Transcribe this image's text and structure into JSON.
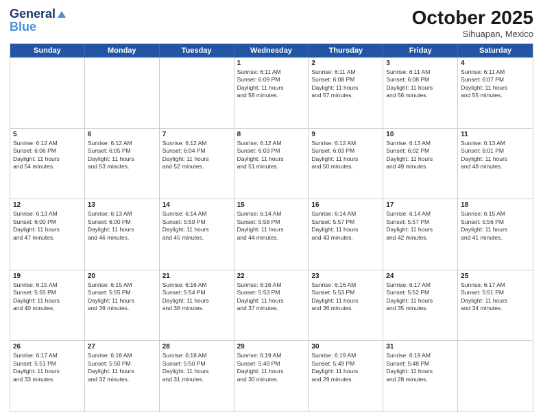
{
  "header": {
    "logo_line1": "General",
    "logo_line2": "Blue",
    "month": "October 2025",
    "location": "Sihuapan, Mexico"
  },
  "weekdays": [
    "Sunday",
    "Monday",
    "Tuesday",
    "Wednesday",
    "Thursday",
    "Friday",
    "Saturday"
  ],
  "rows": [
    [
      {
        "day": "",
        "lines": []
      },
      {
        "day": "",
        "lines": []
      },
      {
        "day": "",
        "lines": []
      },
      {
        "day": "1",
        "lines": [
          "Sunrise: 6:11 AM",
          "Sunset: 6:09 PM",
          "Daylight: 11 hours",
          "and 58 minutes."
        ]
      },
      {
        "day": "2",
        "lines": [
          "Sunrise: 6:11 AM",
          "Sunset: 6:08 PM",
          "Daylight: 11 hours",
          "and 57 minutes."
        ]
      },
      {
        "day": "3",
        "lines": [
          "Sunrise: 6:11 AM",
          "Sunset: 6:08 PM",
          "Daylight: 11 hours",
          "and 56 minutes."
        ]
      },
      {
        "day": "4",
        "lines": [
          "Sunrise: 6:11 AM",
          "Sunset: 6:07 PM",
          "Daylight: 11 hours",
          "and 55 minutes."
        ]
      }
    ],
    [
      {
        "day": "5",
        "lines": [
          "Sunrise: 6:12 AM",
          "Sunset: 6:06 PM",
          "Daylight: 11 hours",
          "and 54 minutes."
        ]
      },
      {
        "day": "6",
        "lines": [
          "Sunrise: 6:12 AM",
          "Sunset: 6:05 PM",
          "Daylight: 11 hours",
          "and 53 minutes."
        ]
      },
      {
        "day": "7",
        "lines": [
          "Sunrise: 6:12 AM",
          "Sunset: 6:04 PM",
          "Daylight: 11 hours",
          "and 52 minutes."
        ]
      },
      {
        "day": "8",
        "lines": [
          "Sunrise: 6:12 AM",
          "Sunset: 6:03 PM",
          "Daylight: 11 hours",
          "and 51 minutes."
        ]
      },
      {
        "day": "9",
        "lines": [
          "Sunrise: 6:12 AM",
          "Sunset: 6:03 PM",
          "Daylight: 11 hours",
          "and 50 minutes."
        ]
      },
      {
        "day": "10",
        "lines": [
          "Sunrise: 6:13 AM",
          "Sunset: 6:02 PM",
          "Daylight: 11 hours",
          "and 49 minutes."
        ]
      },
      {
        "day": "11",
        "lines": [
          "Sunrise: 6:13 AM",
          "Sunset: 6:01 PM",
          "Daylight: 11 hours",
          "and 48 minutes."
        ]
      }
    ],
    [
      {
        "day": "12",
        "lines": [
          "Sunrise: 6:13 AM",
          "Sunset: 6:00 PM",
          "Daylight: 11 hours",
          "and 47 minutes."
        ]
      },
      {
        "day": "13",
        "lines": [
          "Sunrise: 6:13 AM",
          "Sunset: 6:00 PM",
          "Daylight: 11 hours",
          "and 46 minutes."
        ]
      },
      {
        "day": "14",
        "lines": [
          "Sunrise: 6:14 AM",
          "Sunset: 5:59 PM",
          "Daylight: 11 hours",
          "and 45 minutes."
        ]
      },
      {
        "day": "15",
        "lines": [
          "Sunrise: 6:14 AM",
          "Sunset: 5:58 PM",
          "Daylight: 11 hours",
          "and 44 minutes."
        ]
      },
      {
        "day": "16",
        "lines": [
          "Sunrise: 6:14 AM",
          "Sunset: 5:57 PM",
          "Daylight: 11 hours",
          "and 43 minutes."
        ]
      },
      {
        "day": "17",
        "lines": [
          "Sunrise: 6:14 AM",
          "Sunset: 5:57 PM",
          "Daylight: 11 hours",
          "and 42 minutes."
        ]
      },
      {
        "day": "18",
        "lines": [
          "Sunrise: 6:15 AM",
          "Sunset: 5:56 PM",
          "Daylight: 11 hours",
          "and 41 minutes."
        ]
      }
    ],
    [
      {
        "day": "19",
        "lines": [
          "Sunrise: 6:15 AM",
          "Sunset: 5:55 PM",
          "Daylight: 11 hours",
          "and 40 minutes."
        ]
      },
      {
        "day": "20",
        "lines": [
          "Sunrise: 6:15 AM",
          "Sunset: 5:55 PM",
          "Daylight: 11 hours",
          "and 39 minutes."
        ]
      },
      {
        "day": "21",
        "lines": [
          "Sunrise: 6:16 AM",
          "Sunset: 5:54 PM",
          "Daylight: 11 hours",
          "and 38 minutes."
        ]
      },
      {
        "day": "22",
        "lines": [
          "Sunrise: 6:16 AM",
          "Sunset: 5:53 PM",
          "Daylight: 11 hours",
          "and 37 minutes."
        ]
      },
      {
        "day": "23",
        "lines": [
          "Sunrise: 6:16 AM",
          "Sunset: 5:53 PM",
          "Daylight: 11 hours",
          "and 36 minutes."
        ]
      },
      {
        "day": "24",
        "lines": [
          "Sunrise: 6:17 AM",
          "Sunset: 5:52 PM",
          "Daylight: 11 hours",
          "and 35 minutes."
        ]
      },
      {
        "day": "25",
        "lines": [
          "Sunrise: 6:17 AM",
          "Sunset: 5:51 PM",
          "Daylight: 11 hours",
          "and 34 minutes."
        ]
      }
    ],
    [
      {
        "day": "26",
        "lines": [
          "Sunrise: 6:17 AM",
          "Sunset: 5:51 PM",
          "Daylight: 11 hours",
          "and 33 minutes."
        ]
      },
      {
        "day": "27",
        "lines": [
          "Sunrise: 6:18 AM",
          "Sunset: 5:50 PM",
          "Daylight: 11 hours",
          "and 32 minutes."
        ]
      },
      {
        "day": "28",
        "lines": [
          "Sunrise: 6:18 AM",
          "Sunset: 5:50 PM",
          "Daylight: 11 hours",
          "and 31 minutes."
        ]
      },
      {
        "day": "29",
        "lines": [
          "Sunrise: 6:19 AM",
          "Sunset: 5:49 PM",
          "Daylight: 11 hours",
          "and 30 minutes."
        ]
      },
      {
        "day": "30",
        "lines": [
          "Sunrise: 6:19 AM",
          "Sunset: 5:49 PM",
          "Daylight: 11 hours",
          "and 29 minutes."
        ]
      },
      {
        "day": "31",
        "lines": [
          "Sunrise: 6:19 AM",
          "Sunset: 5:48 PM",
          "Daylight: 11 hours",
          "and 28 minutes."
        ]
      },
      {
        "day": "",
        "lines": []
      }
    ]
  ]
}
